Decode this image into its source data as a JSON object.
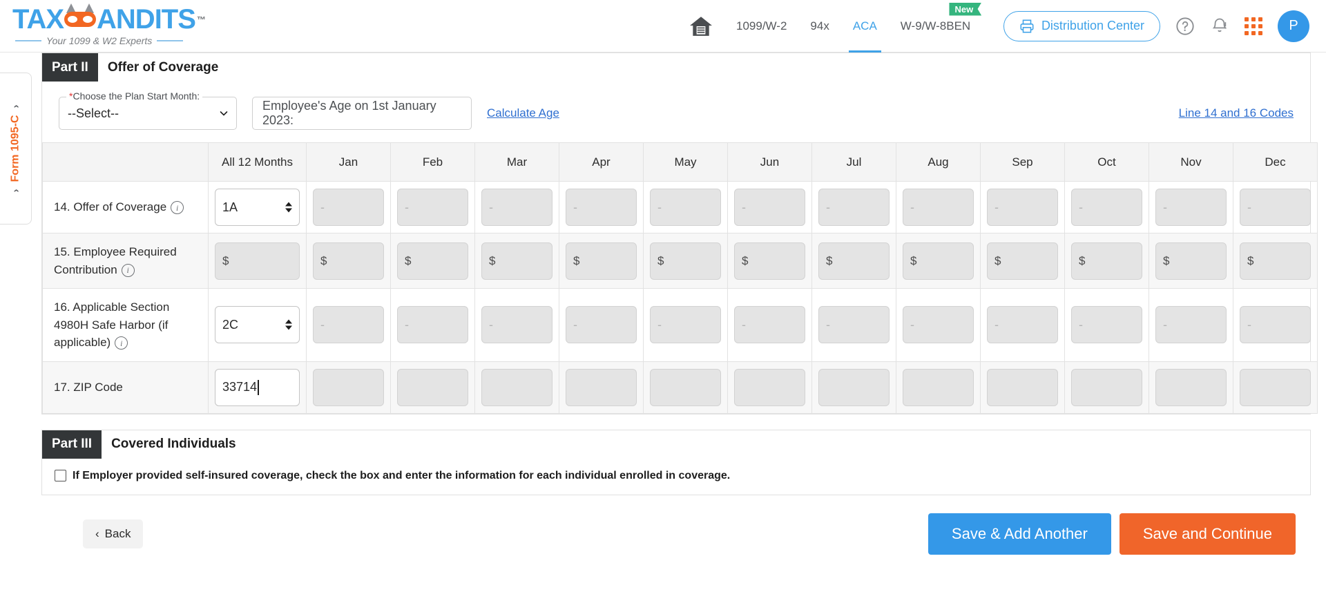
{
  "brand": {
    "name_part1": "TAX",
    "name_part2": "ANDITS",
    "tm": "™",
    "tagline": "Your 1099 & W2 Experts"
  },
  "header": {
    "home_icon": "home-icon",
    "nav": [
      {
        "label": "1099/W-2",
        "active": false,
        "badge": null
      },
      {
        "label": "94x",
        "active": false,
        "badge": null
      },
      {
        "label": "ACA",
        "active": true,
        "badge": null
      },
      {
        "label": "W-9/W-8BEN",
        "active": false,
        "badge": "New"
      }
    ],
    "distribution_center": "Distribution Center",
    "printer_icon": "printer-icon",
    "help_icon": "help-circle-icon",
    "bell_icon": "bell-alert-icon",
    "apps_icon": "apps-grid-icon",
    "avatar_initial": "P"
  },
  "side_tab": {
    "label": "Form 1095-C",
    "chevron": "›"
  },
  "part2": {
    "tag": "Part II",
    "title": "Offer of Coverage",
    "plan_start_month": {
      "legend": "Choose the Plan Start Month:",
      "required_mark": "*",
      "value": "--Select--"
    },
    "employee_age": {
      "placeholder": "Employee's Age on 1st January 2023:",
      "value": ""
    },
    "calculate_age_link": "Calculate Age",
    "codes_link": "Line 14 and 16 Codes"
  },
  "table": {
    "columns": [
      "",
      "All 12 Months",
      "Jan",
      "Feb",
      "Mar",
      "Apr",
      "May",
      "Jun",
      "Jul",
      "Aug",
      "Sep",
      "Oct",
      "Nov",
      "Dec"
    ],
    "rows": [
      {
        "label": "14. Offer of Coverage",
        "has_info": true,
        "type": "select",
        "all12_value": "1A",
        "months": [
          "-",
          "-",
          "-",
          "-",
          "-",
          "-",
          "-",
          "-",
          "-",
          "-",
          "-",
          "-"
        ],
        "striped": false
      },
      {
        "label": "15. Employee Required Contribution",
        "has_info": true,
        "type": "money",
        "all12_value": "",
        "prefix": "$",
        "months": [
          "",
          "",
          "",
          "",
          "",
          "",
          "",
          "",
          "",
          "",
          "",
          ""
        ],
        "striped": true
      },
      {
        "label": "16. Applicable Section 4980H Safe Harbor (if applicable)",
        "has_info": true,
        "type": "select",
        "all12_value": "2C",
        "months": [
          "-",
          "-",
          "-",
          "-",
          "-",
          "-",
          "-",
          "-",
          "-",
          "-",
          "-",
          "-"
        ],
        "striped": false
      },
      {
        "label": "17. ZIP Code",
        "has_info": false,
        "type": "text",
        "all12_value": "33714",
        "all12_focused": true,
        "months": [
          "",
          "",
          "",
          "",
          "",
          "",
          "",
          "",
          "",
          "",
          "",
          ""
        ],
        "striped": true
      }
    ]
  },
  "part3": {
    "tag": "Part III",
    "title": "Covered Individuals",
    "checkbox_checked": false,
    "checkbox_label": "If Employer provided self-insured coverage, check the box and enter the information for each individual enrolled in coverage."
  },
  "footer": {
    "back_label": "Back",
    "back_chevron": "‹",
    "save_add_another": "Save & Add Another",
    "save_continue": "Save and Continue"
  },
  "colors": {
    "brand_blue": "#3fa2e8",
    "brand_orange": "#f26722",
    "accent_orange": "#f0652a",
    "primary_blue": "#3498e8",
    "badge_green": "#35b57e",
    "dark_header": "#333638",
    "all12_gray": "#6b6b6b",
    "link_blue": "#2f6fd0"
  }
}
